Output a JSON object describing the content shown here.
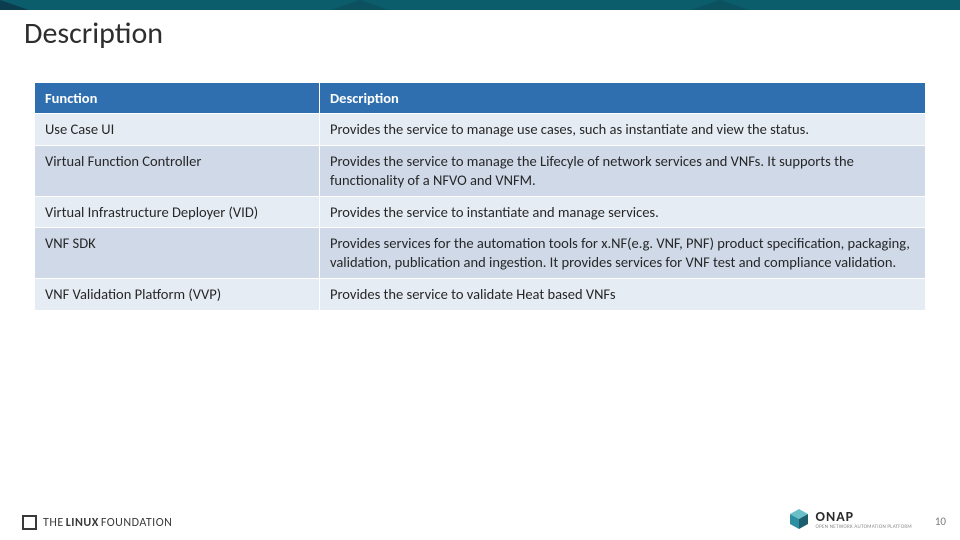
{
  "title": "Description",
  "table": {
    "headers": {
      "function": "Function",
      "description": "Description"
    },
    "rows": [
      {
        "function": "Use Case UI",
        "description": "Provides the service to manage use cases, such as instantiate and view the status."
      },
      {
        "function": "Virtual Function Controller",
        "description": "Provides the service to manage the Lifecyle of network services and VNFs.  It supports the functionality of a NFVO and VNFM."
      },
      {
        "function": "Virtual Infrastructure Deployer (VID)",
        "description": "Provides the service to instantiate and manage services."
      },
      {
        "function": "VNF SDK",
        "description": "Provides services for the automation tools for x.NF(e.g. VNF, PNF) product specification, packaging, validation, publication and ingestion. It provides services for VNF test and compliance validation."
      },
      {
        "function": "VNF Validation Platform (VVP)",
        "description": "Provides the service to validate Heat based VNFs"
      }
    ]
  },
  "footer": {
    "linux_pre": "THE",
    "linux_mid": "LINUX",
    "linux_post": "FOUNDATION",
    "onap": "ONAP",
    "onap_sub": "OPEN NETWORK AUTOMATION PLATFORM"
  },
  "page_number": "10"
}
